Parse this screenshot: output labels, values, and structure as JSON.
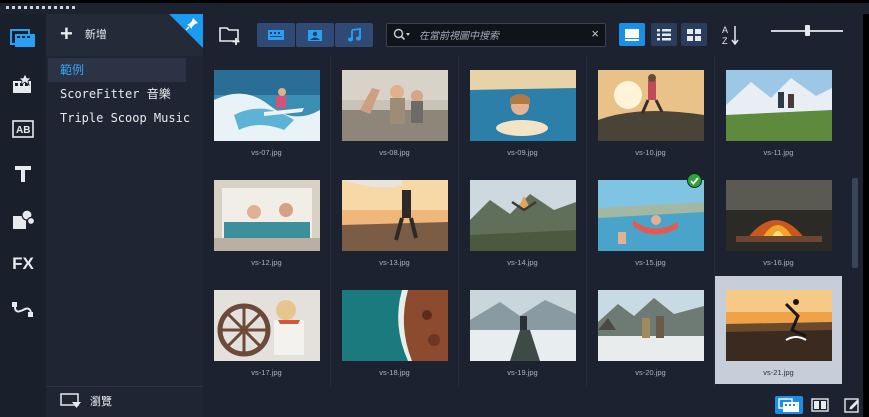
{
  "tree": {
    "add_label": "新增",
    "items": [
      "範例",
      "ScoreFitter 音樂",
      "Triple Scoop Music"
    ],
    "browse_label": "瀏覽"
  },
  "toolbar": {
    "search_placeholder": "在當前視圖中搜索",
    "slider_level": 0.5
  },
  "icons": [
    "media-icon",
    "instant-project-icon",
    "title-icon",
    "text-icon",
    "graphics-icon",
    "fx-icon",
    "transition-icon",
    "folder-add-icon",
    "video-filter-icon",
    "photo-filter-icon",
    "audio-filter-icon",
    "search-icon",
    "clear-icon",
    "thumbnail-view-icon",
    "list-view-icon",
    "grid-view-icon",
    "sort-icon",
    "pin-icon",
    "browse-icon"
  ],
  "rail": {
    "fx_label": "FX"
  },
  "media": [
    {
      "name": "vs-07.jpg"
    },
    {
      "name": "vs-08.jpg"
    },
    {
      "name": "vs-09.jpg"
    },
    {
      "name": "vs-10.jpg"
    },
    {
      "name": "vs-11.jpg"
    },
    {
      "name": "vs-12.jpg"
    },
    {
      "name": "vs-13.jpg"
    },
    {
      "name": "vs-14.jpg"
    },
    {
      "name": "vs-15.jpg",
      "checked": true
    },
    {
      "name": "vs-16.jpg"
    },
    {
      "name": "vs-17.jpg"
    },
    {
      "name": "vs-18.jpg"
    },
    {
      "name": "vs-19.jpg"
    },
    {
      "name": "vs-20.jpg"
    },
    {
      "name": "vs-21.jpg",
      "selected": true
    }
  ],
  "colors": {
    "accent": "#1a8fe8",
    "panel": "#1f2532",
    "background": "#1c2230",
    "check": "#2ca33b"
  }
}
